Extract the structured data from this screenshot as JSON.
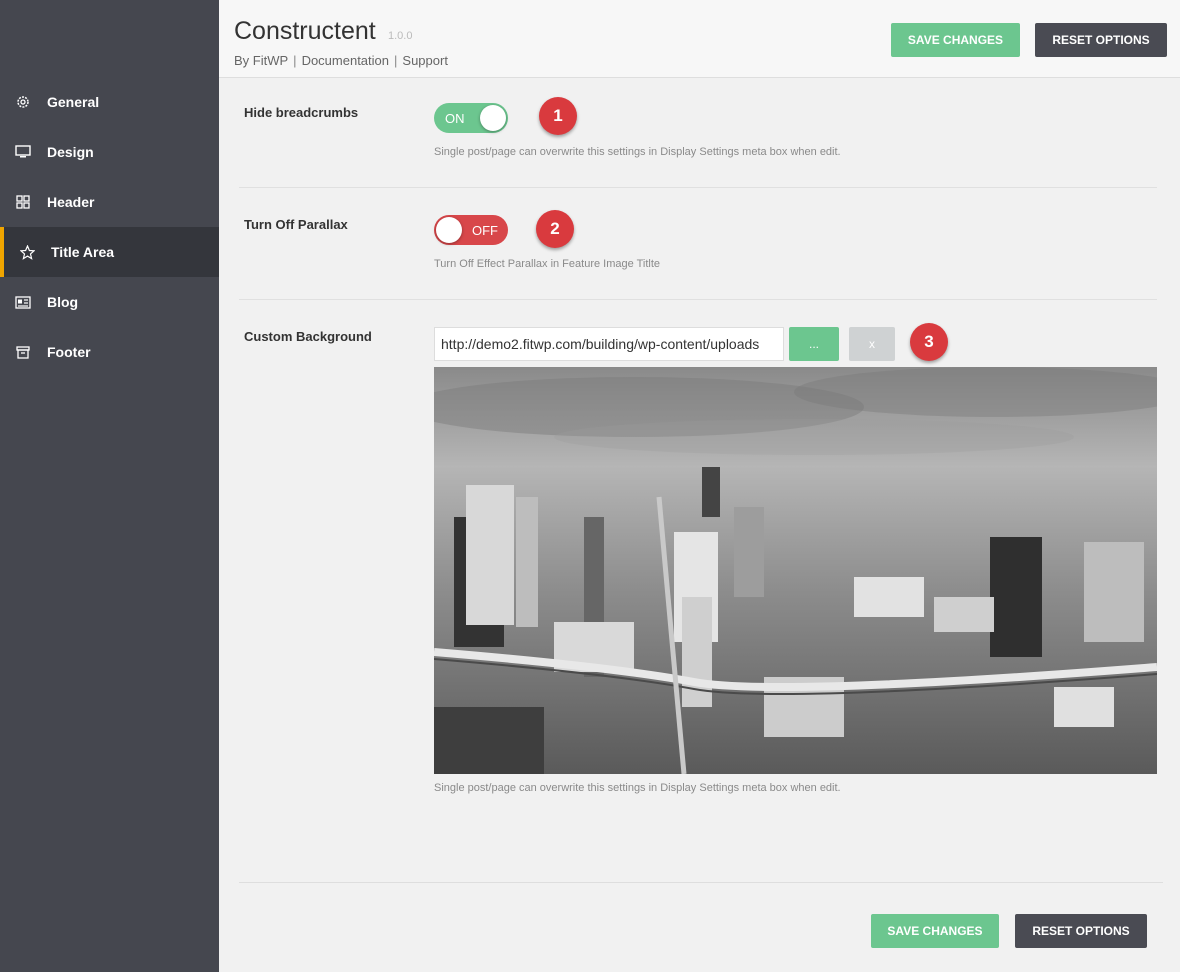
{
  "sidebar": {
    "items": [
      {
        "label": "General",
        "icon": "gear-icon"
      },
      {
        "label": "Design",
        "icon": "monitor-icon"
      },
      {
        "label": "Header",
        "icon": "grid-icon"
      },
      {
        "label": "Title Area",
        "icon": "star-icon",
        "active": true
      },
      {
        "label": "Blog",
        "icon": "newspaper-icon"
      },
      {
        "label": "Footer",
        "icon": "archive-icon"
      }
    ]
  },
  "header": {
    "title": "Constructent",
    "version": "1.0.0",
    "links": [
      "By FitWP",
      "Documentation",
      "Support"
    ],
    "save_label": "SAVE CHANGES",
    "reset_label": "RESET OPTIONS"
  },
  "settings": {
    "hide_breadcrumbs": {
      "label": "Hide breadcrumbs",
      "toggle_text": "ON",
      "description": "Single post/page can overwrite this settings in Display Settings meta box when edit.",
      "badge": "1"
    },
    "parallax": {
      "label": "Turn Off Parallax",
      "toggle_text": "OFF",
      "description": "Turn Off Effect Parallax in Feature Image Titlte",
      "badge": "2"
    },
    "custom_background": {
      "label": "Custom Background",
      "url": "http://demo2.fitwp.com/building/wp-content/uploads",
      "browse_label": "...",
      "remove_label": "x",
      "description": "Single post/page can overwrite this settings in Display Settings meta box when edit.",
      "badge": "3"
    }
  },
  "footer": {
    "save_label": "SAVE CHANGES",
    "reset_label": "RESET OPTIONS"
  },
  "colors": {
    "sidebar_bg": "#45474f",
    "accent": "#f0a500",
    "save_green": "#6cc68f",
    "reset_dark": "#4a4b53",
    "off_red": "#d8474a"
  }
}
